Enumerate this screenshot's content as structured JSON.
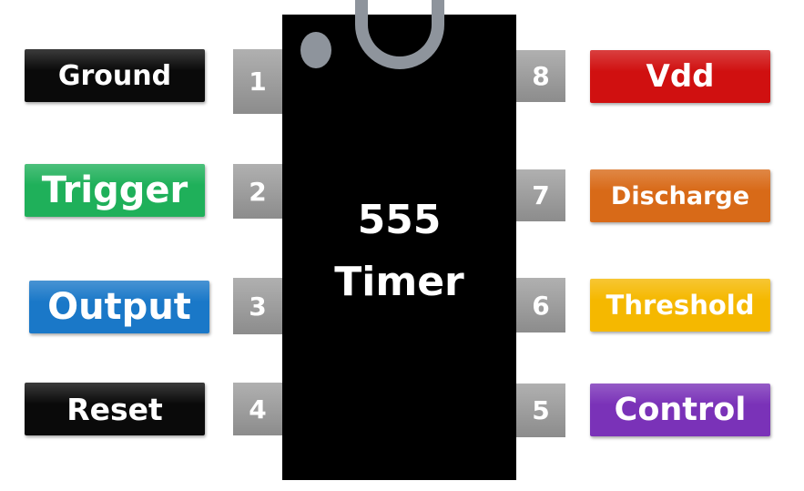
{
  "chip": {
    "title_line1": "555",
    "title_line2": "Timer"
  },
  "pins": [
    {
      "number": "1",
      "label": "Ground",
      "color": "#0a0a0a"
    },
    {
      "number": "2",
      "label": "Trigger",
      "color": "#1fb05a"
    },
    {
      "number": "3",
      "label": "Output",
      "color": "#1a78c8"
    },
    {
      "number": "4",
      "label": "Reset",
      "color": "#0a0a0a"
    },
    {
      "number": "5",
      "label": "Control",
      "color": "#7a32b8"
    },
    {
      "number": "6",
      "label": "Threshold",
      "color": "#f5b800"
    },
    {
      "number": "7",
      "label": "Discharge",
      "color": "#d86a18"
    },
    {
      "number": "8",
      "label": "Vdd",
      "color": "#d01010"
    }
  ]
}
